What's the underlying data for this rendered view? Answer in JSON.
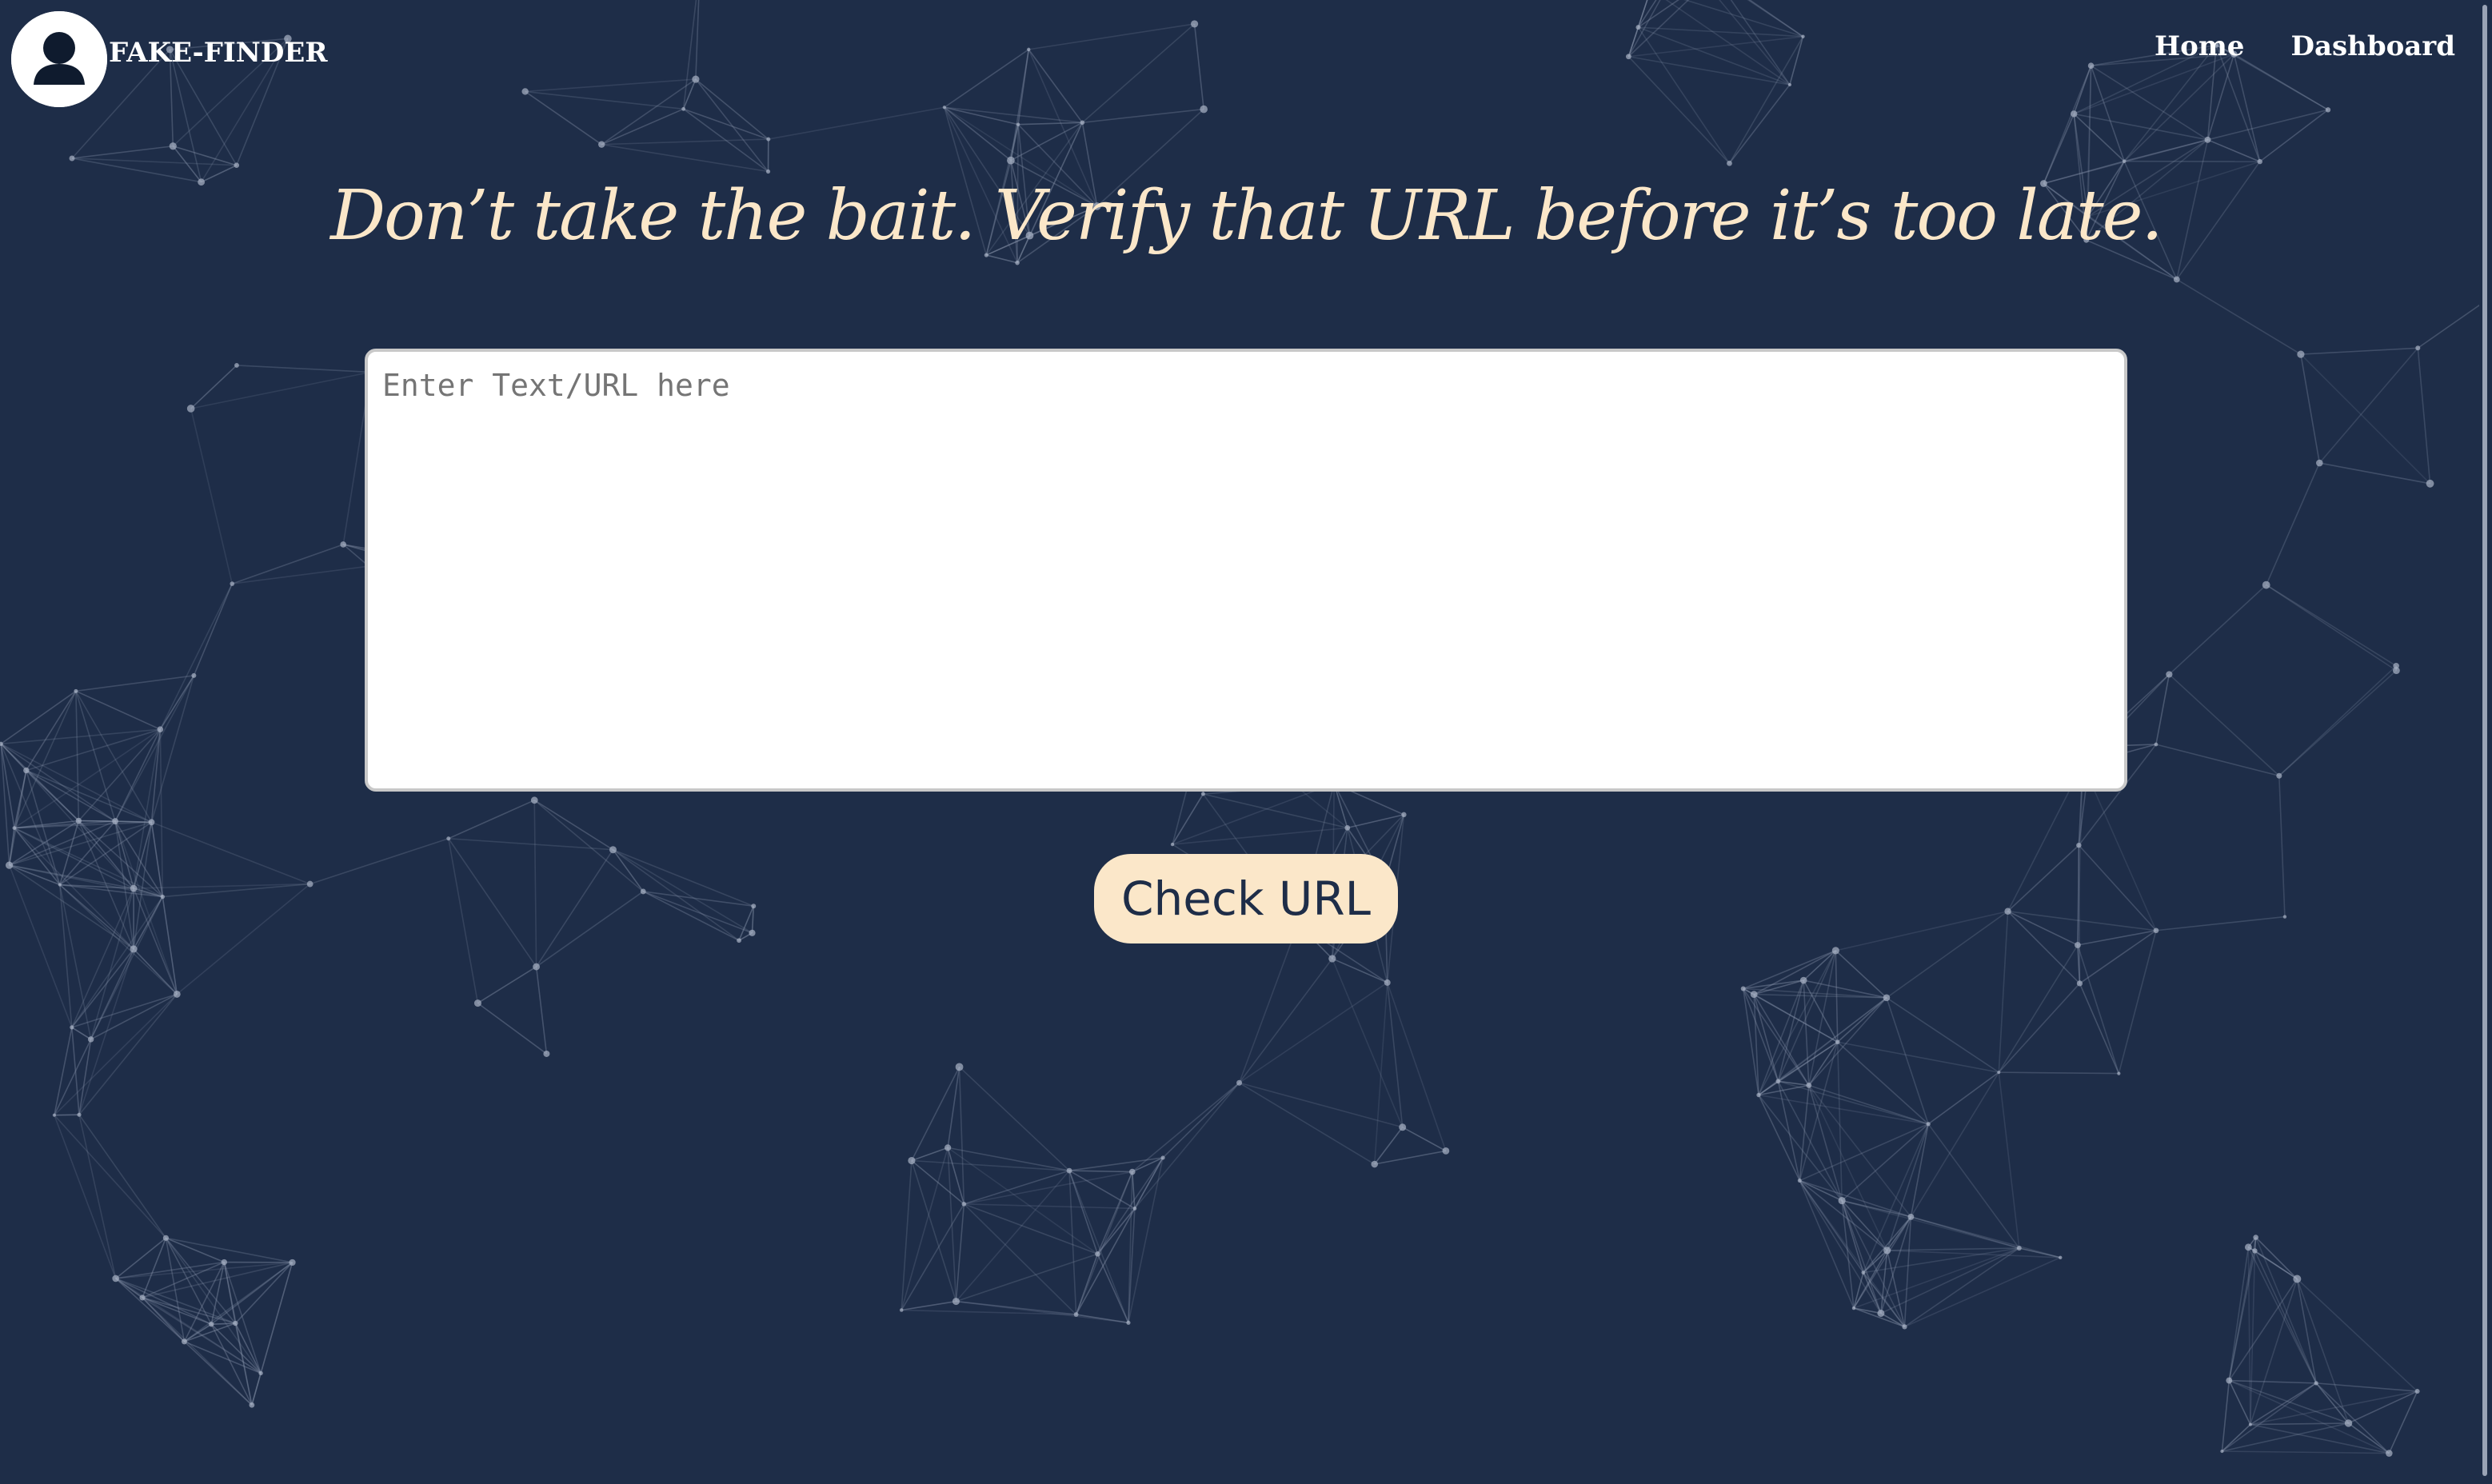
{
  "header": {
    "brand": "FAKE-FINDER",
    "logo_icon": "user-avatar-icon",
    "nav": [
      {
        "label": "Home"
      },
      {
        "label": "Dashboard"
      }
    ]
  },
  "main": {
    "headline": "Don’t take the bait. Verify that URL before it’s too late.",
    "input": {
      "placeholder": "Enter Text/URL here",
      "value": ""
    },
    "check_button": "Check URL"
  },
  "colors": {
    "background": "#1e2d48",
    "accent": "#fbe7c9",
    "network_lines": "#8a96ad"
  }
}
